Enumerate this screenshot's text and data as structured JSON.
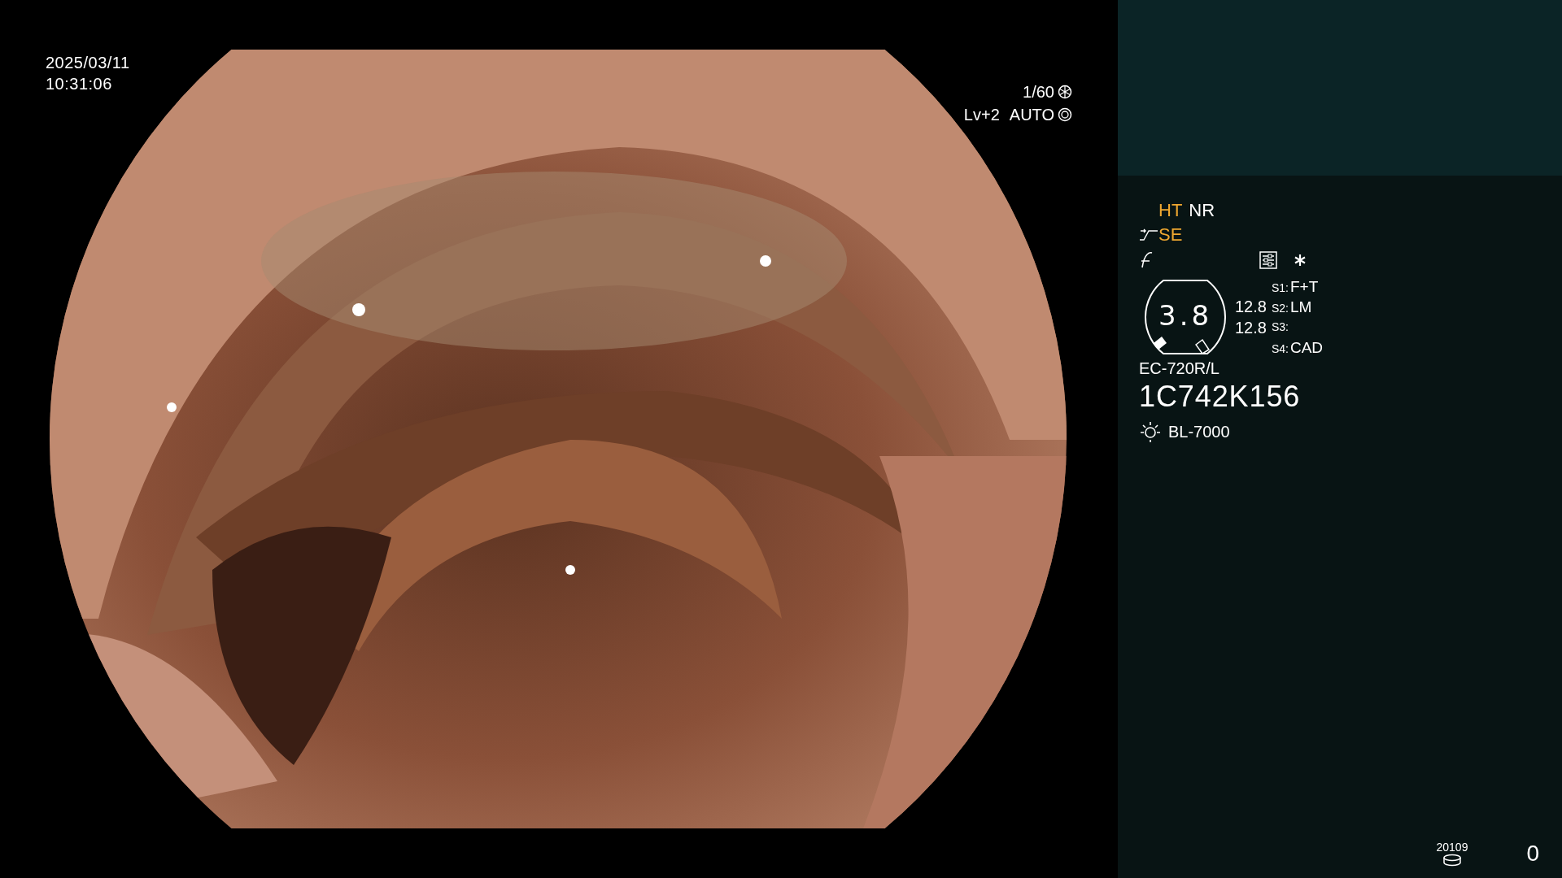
{
  "date": "2025/03/11",
  "time": "10:31:06",
  "shutter": {
    "speed": "1/60",
    "level": "Lv+2",
    "mode": "AUTO"
  },
  "modes_row1": [
    {
      "label": "HT",
      "color": "#f0a830"
    },
    {
      "label": "NR",
      "color": "#ffffff"
    }
  ],
  "mode_row2": {
    "label": "SE",
    "color": "#f0a830"
  },
  "gauge": {
    "value": "3.8",
    "readings": [
      "12.8",
      "12.8"
    ]
  },
  "switches": [
    {
      "key": "S1:",
      "value": "F+T"
    },
    {
      "key": "S2:",
      "value": "LM"
    },
    {
      "key": "S3:"
    },
    {
      "key": "S4:",
      "value": "CAD"
    }
  ],
  "scope_model": "EC-720R/L",
  "scope_serial": "1C742K156",
  "light_source": "BL-7000",
  "storage": {
    "count": "20109",
    "index": "0"
  }
}
